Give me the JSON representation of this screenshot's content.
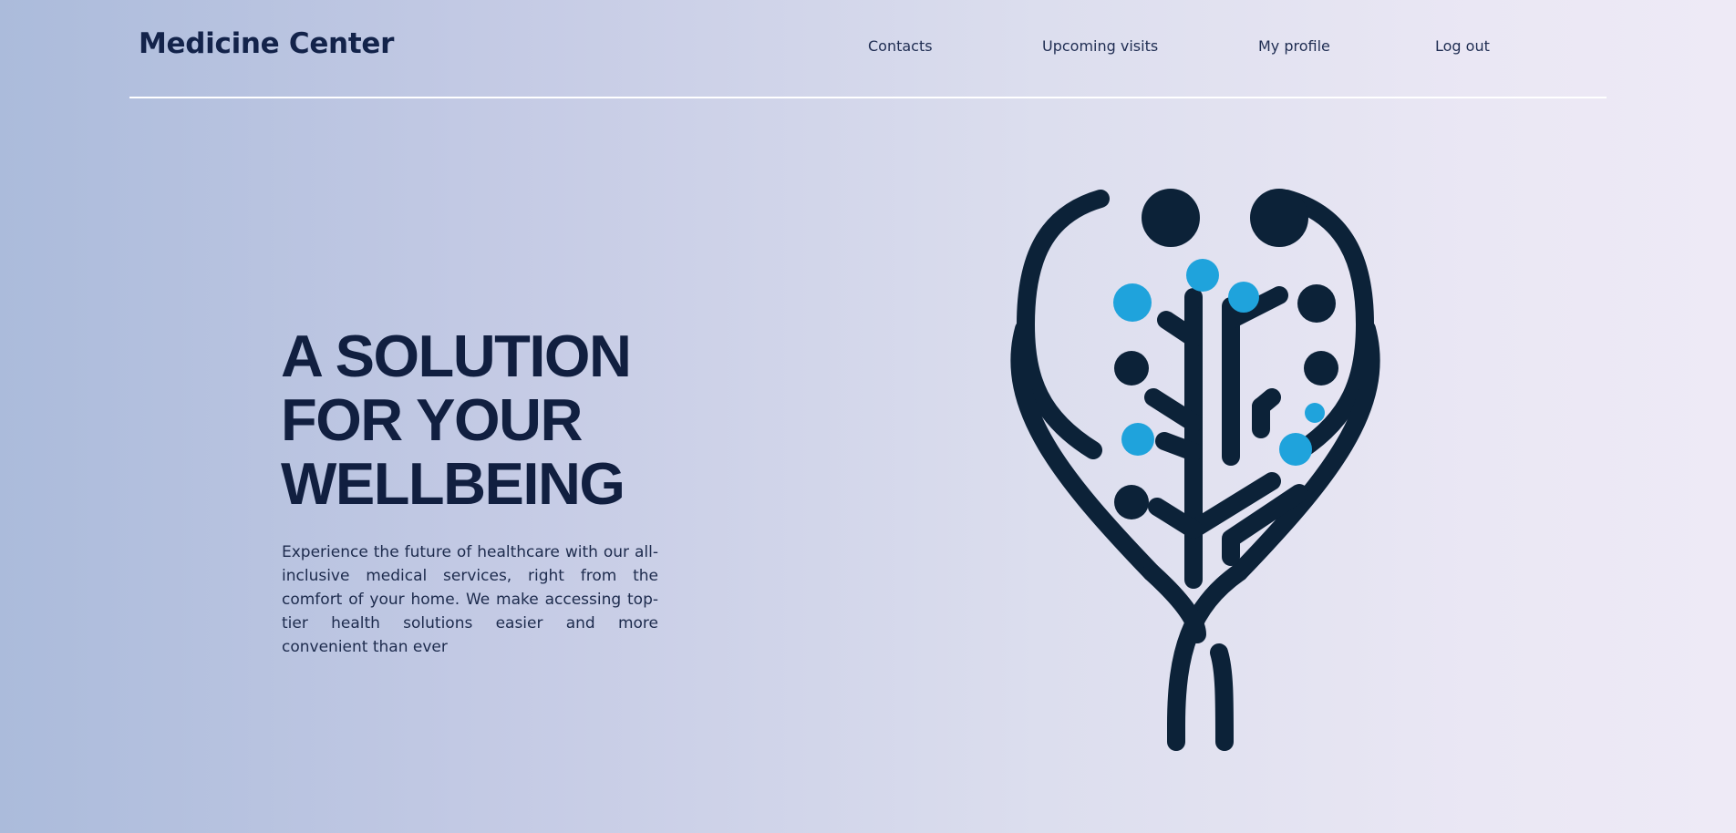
{
  "header": {
    "brand": "Medicine Center",
    "nav": {
      "contacts": "Contacts",
      "upcoming_visits": "Upcoming visits",
      "my_profile": "My profile",
      "log_out": "Log out"
    }
  },
  "hero": {
    "title_lines": [
      "A SOLUTION",
      "FOR YOUR",
      "WELLBEING"
    ],
    "description": "Experience the future of healthcare with our all-inclusive medical services, right from the comfort of your home. We make accessing top-tier health solutions easier and more convenient than ever"
  },
  "logo": {
    "icon": "stethoscope-tree-heart-icon",
    "colors": {
      "dark": "#0c2238",
      "accent": "#1fa3dc"
    }
  },
  "colors": {
    "background_left": "#abbbdb",
    "background_right": "#eeeaf6",
    "text_dark": "#111f40",
    "divider": "#ffffff"
  }
}
